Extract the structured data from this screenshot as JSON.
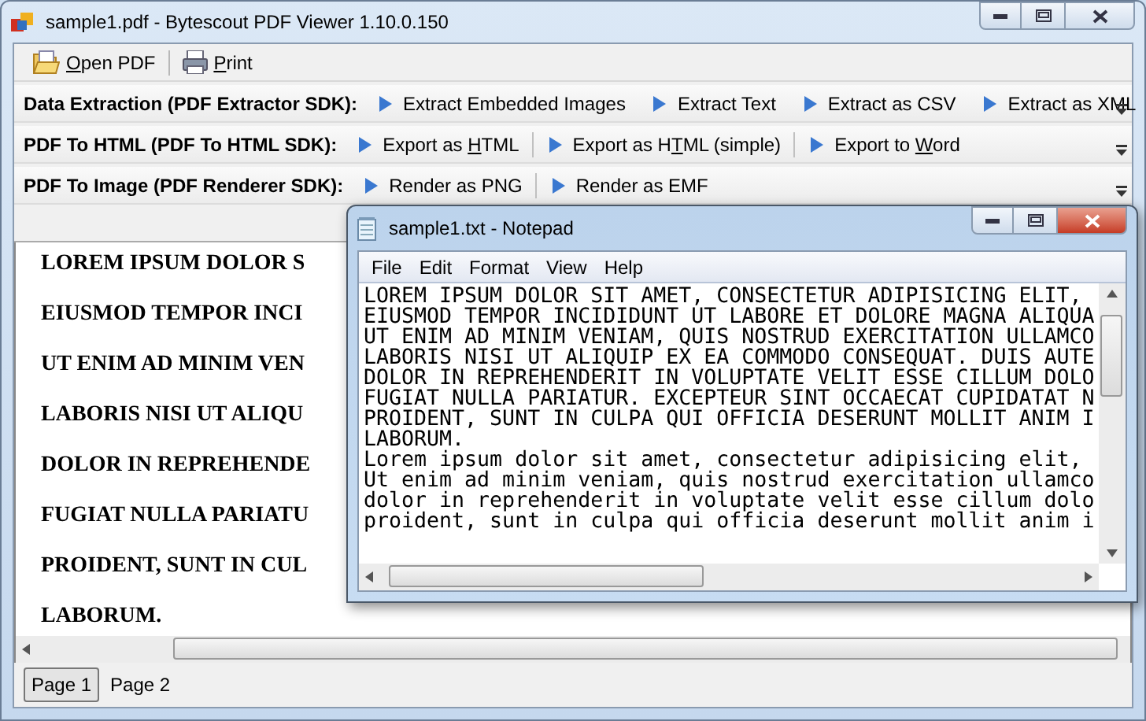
{
  "window": {
    "title": "sample1.pdf - Bytescout PDF Viewer 1.10.0.150"
  },
  "main_toolbar": [
    {
      "label": "**O**pen PDF",
      "kind": "open"
    },
    {
      "label": "**P**rint",
      "kind": "print"
    }
  ],
  "toolbars": [
    {
      "label": "Data Extraction (PDF Extractor SDK):",
      "buttons": [
        "Extract Embedded Images",
        "Extract Text",
        "Extract as CSV",
        "Extract as XML"
      ]
    },
    {
      "label": "PDF To HTML (PDF To HTML SDK):",
      "buttons": [
        "Export as **H**TML",
        "Export as H**T**ML (simple)",
        "Export to **W**ord"
      ]
    },
    {
      "label": "PDF To Image (PDF Renderer SDK):",
      "buttons": [
        "Render as PNG",
        "Render as EMF"
      ]
    }
  ],
  "document_lines": [
    "LOREM IPSUM DOLOR S",
    "EIUSMOD TEMPOR INCI",
    "UT ENIM AD MINIM VEN",
    "LABORIS NISI UT ALIQU",
    "DOLOR IN REPREHENDE",
    "FUGIAT NULLA PARIATU",
    "PROIDENT, SUNT IN CUL",
    "LABORUM."
  ],
  "pages": [
    {
      "label": "Page 1",
      "selected": true
    },
    {
      "label": "Page 2",
      "selected": false
    }
  ],
  "notepad": {
    "title": "sample1.txt - Notepad",
    "menu": [
      "File",
      "Edit",
      "Format",
      "View",
      "Help"
    ],
    "lines": [
      "LOREM IPSUM DOLOR SIT AMET, CONSECTETUR ADIPISICING ELIT,",
      "EIUSMOD TEMPOR INCIDIDUNT UT LABORE ET DOLORE MAGNA ALIQUA",
      "UT ENIM AD MINIM VENIAM, QUIS NOSTRUD EXERCITATION ULLAMCO",
      "LABORIS NISI UT ALIQUIP EX EA COMMODO CONSEQUAT. DUIS AUTE",
      "DOLOR IN REPREHENDERIT IN VOLUPTATE VELIT ESSE CILLUM DOLO",
      "FUGIAT NULLA PARIATUR. EXCEPTEUR SINT OCCAECAT CUPIDATAT N",
      "PROIDENT, SUNT IN CULPA QUI OFFICIA DESERUNT MOLLIT ANIM I",
      "LABORUM.",
      "Lorem ipsum dolor sit amet, consectetur adipisicing elit,",
      "Ut enim ad minim veniam, quis nostrud exercitation ullamco",
      "dolor in reprehenderit in voluptate velit esse cillum dolo",
      "proident, sunt in culpa qui officia deserunt mollit anim i"
    ]
  }
}
